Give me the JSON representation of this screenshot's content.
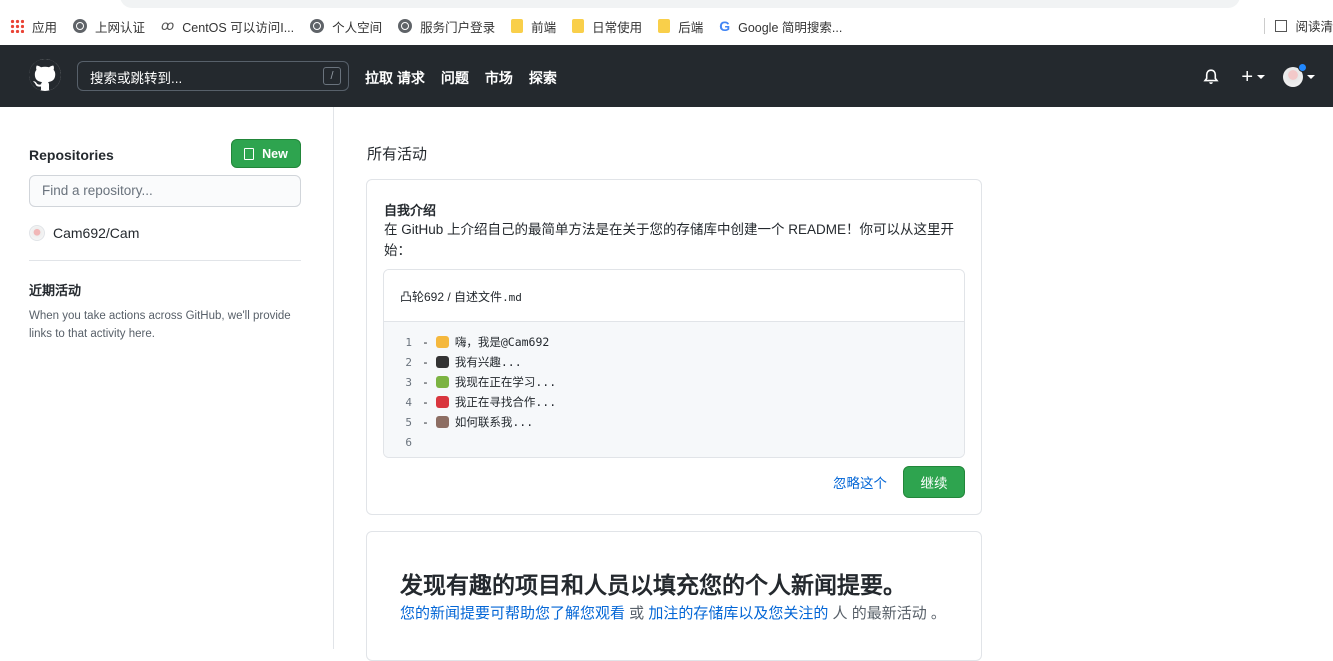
{
  "browser": {
    "bookmarks": [
      {
        "label": "应用",
        "icon": "apps-icon"
      },
      {
        "label": "上网认证",
        "icon": "globe-icon"
      },
      {
        "label": "CentOS 可以访问I...",
        "icon": "centos-icon"
      },
      {
        "label": "个人空间",
        "icon": "globe-icon"
      },
      {
        "label": "服务门户登录",
        "icon": "globe-icon"
      },
      {
        "label": "前端",
        "icon": "folder-icon"
      },
      {
        "label": "日常使用",
        "icon": "folder-icon"
      },
      {
        "label": "后端",
        "icon": "folder-icon"
      },
      {
        "label": "Google 简明搜索...",
        "icon": "google-icon"
      }
    ],
    "reading_list": "阅读清"
  },
  "header": {
    "search_placeholder": "搜索或跳转到...",
    "search_shortcut": "/",
    "nav": [
      "拉取 请求",
      "问题",
      "市场",
      "探索"
    ],
    "plus": "+"
  },
  "sidebar": {
    "repositories_title": "Repositories",
    "new_button": "New",
    "filter_placeholder": "Find a repository...",
    "repos": [
      {
        "name": "Cam692/Cam"
      }
    ],
    "recent_title": "近期活动",
    "recent_text": "When you take actions across GitHub, we'll provide links to that activity here."
  },
  "main": {
    "title": "所有活动",
    "intro_card": {
      "title": "自我介绍",
      "description": "在 GitHub 上介绍自己的最简单方法是在关于您的存储库中创建一个 README！你可以从这里开始：",
      "file_path_user": "凸轮692",
      "file_path_sep": " / ",
      "file_path_name": "自述文件",
      "file_path_ext": ".md",
      "lines": [
        {
          "num": "1",
          "text": "- ",
          "emoji": "wave",
          "emoji_color": "#f5b83d",
          "content": "嗨，我是@Cam692"
        },
        {
          "num": "2",
          "text": "- ",
          "emoji": "eyes",
          "emoji_color": "#333333",
          "content": "我有兴趣..."
        },
        {
          "num": "3",
          "text": "- ",
          "emoji": "seedling",
          "emoji_color": "#7cb342",
          "content": "我现在正在学习..."
        },
        {
          "num": "4",
          "text": "- ",
          "emoji": "ledger",
          "emoji_color": "#d9363e",
          "content": "我正在寻找合作..."
        },
        {
          "num": "5",
          "text": "- ",
          "emoji": "mailbox",
          "emoji_color": "#8d6e63",
          "content": "如何联系我..."
        },
        {
          "num": "6",
          "text": "",
          "emoji": "",
          "emoji_color": "",
          "content": ""
        }
      ],
      "skip_label": "忽略这个",
      "continue_label": "继续"
    },
    "discover_card": {
      "title": "发现有趣的项目和人员以填充您的个人新闻提要。",
      "desc_link1": "您的新闻提要可帮助您了解您观看",
      "desc_mid": " 或 ",
      "desc_link2": "加注的存储库以及您关注的",
      "desc_end": " 人 的最新活动 。"
    }
  },
  "colors": {
    "header_bg": "#24292e",
    "primary_green": "#2ea44f",
    "link_blue": "#0366d6"
  }
}
